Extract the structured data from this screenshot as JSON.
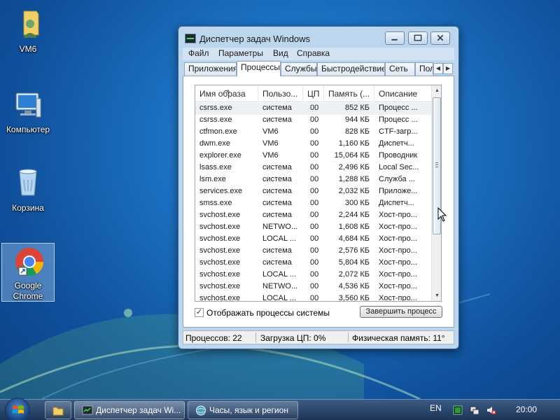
{
  "desktop": {
    "icons": [
      {
        "label": "VM6"
      },
      {
        "label": "Компьютер"
      },
      {
        "label": "Корзина"
      },
      {
        "label_line1": "Google",
        "label_line2": "Chrome"
      }
    ]
  },
  "window": {
    "title": "Диспетчер задач Windows",
    "menu": [
      "Файл",
      "Параметры",
      "Вид",
      "Справка"
    ],
    "tabs": [
      "Приложения",
      "Процессы",
      "Службы",
      "Быстродействие",
      "Сеть",
      "Пол"
    ],
    "active_tab": "Процессы",
    "columns": [
      "Имя образа",
      "Пользо...",
      "ЦП",
      "Память (...",
      "Описание"
    ],
    "processes": [
      {
        "name": "csrss.exe",
        "user": "система",
        "cpu": "00",
        "mem": "852 КБ",
        "desc": "Процесс ..."
      },
      {
        "name": "csrss.exe",
        "user": "система",
        "cpu": "00",
        "mem": "944 КБ",
        "desc": "Процесс ..."
      },
      {
        "name": "ctfmon.exe",
        "user": "VM6",
        "cpu": "00",
        "mem": "828 КБ",
        "desc": "CTF-загр..."
      },
      {
        "name": "dwm.exe",
        "user": "VM6",
        "cpu": "00",
        "mem": "1,160 КБ",
        "desc": "Диспетч..."
      },
      {
        "name": "explorer.exe",
        "user": "VM6",
        "cpu": "00",
        "mem": "15,064 КБ",
        "desc": "Проводник"
      },
      {
        "name": "lsass.exe",
        "user": "система",
        "cpu": "00",
        "mem": "2,496 КБ",
        "desc": "Local Sec..."
      },
      {
        "name": "lsm.exe",
        "user": "система",
        "cpu": "00",
        "mem": "1,288 КБ",
        "desc": "Служба ..."
      },
      {
        "name": "services.exe",
        "user": "система",
        "cpu": "00",
        "mem": "2,032 КБ",
        "desc": "Приложе..."
      },
      {
        "name": "smss.exe",
        "user": "система",
        "cpu": "00",
        "mem": "300 КБ",
        "desc": "Диспетч..."
      },
      {
        "name": "svchost.exe",
        "user": "система",
        "cpu": "00",
        "mem": "2,244 КБ",
        "desc": "Хост-про..."
      },
      {
        "name": "svchost.exe",
        "user": "NETWO...",
        "cpu": "00",
        "mem": "1,608 КБ",
        "desc": "Хост-про..."
      },
      {
        "name": "svchost.exe",
        "user": "LOCAL ...",
        "cpu": "00",
        "mem": "4,684 КБ",
        "desc": "Хост-про..."
      },
      {
        "name": "svchost.exe",
        "user": "система",
        "cpu": "00",
        "mem": "2,576 КБ",
        "desc": "Хост-про..."
      },
      {
        "name": "svchost.exe",
        "user": "система",
        "cpu": "00",
        "mem": "5,804 КБ",
        "desc": "Хост-про..."
      },
      {
        "name": "svchost.exe",
        "user": "LOCAL ...",
        "cpu": "00",
        "mem": "2,072 КБ",
        "desc": "Хост-про..."
      },
      {
        "name": "svchost.exe",
        "user": "NETWO...",
        "cpu": "00",
        "mem": "4,536 КБ",
        "desc": "Хост-про..."
      },
      {
        "name": "svchost.exe",
        "user": "LOCAL ...",
        "cpu": "00",
        "mem": "3,560 КБ",
        "desc": "Хост-про..."
      }
    ],
    "show_all_label": "Отображать процессы системы",
    "show_all_checked": true,
    "end_process_label": "Завершить процесс",
    "status": {
      "processes": "Процессов: 22",
      "cpu": "Загрузка ЦП: 0%",
      "memory": "Физическая память: 11°"
    }
  },
  "taskbar": {
    "buttons": [
      {
        "label": "Диспетчер задач Wi..."
      },
      {
        "label": "Часы, язык и регион"
      }
    ],
    "language": "EN",
    "clock": "20:00"
  }
}
